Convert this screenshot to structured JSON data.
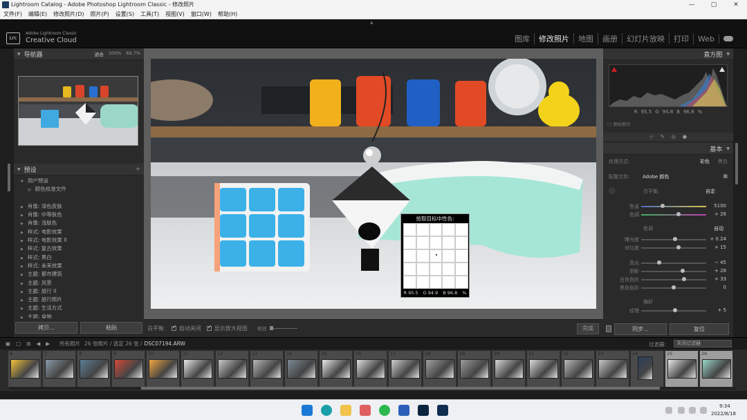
{
  "window": {
    "title": "Lightroom Catalog - Adobe Photoshop Lightroom Classic - 修改照片",
    "controls": [
      "—",
      "▢",
      "✕"
    ]
  },
  "menu": [
    "文件(F)",
    "编辑(E)",
    "修改照片(D)",
    "照片(P)",
    "设置(S)",
    "工具(T)",
    "视图(V)",
    "窗口(W)",
    "帮助(H)"
  ],
  "brand": {
    "logo": "Lrc",
    "line1": "Adobe Lightroom Classic",
    "line2": "Creative Cloud"
  },
  "modules": [
    {
      "label": "图库",
      "active": false
    },
    {
      "label": "修改照片",
      "active": true
    },
    {
      "label": "地图",
      "active": false
    },
    {
      "label": "画册",
      "active": false
    },
    {
      "label": "幻灯片放映",
      "active": false
    },
    {
      "label": "打印",
      "active": false
    },
    {
      "label": "Web",
      "active": false
    }
  ],
  "navigator": {
    "title": "导航器",
    "zoom": [
      "适合",
      "100%",
      "66.7%"
    ]
  },
  "presets": {
    "title": "预设",
    "items": [
      {
        "label": "用户预设",
        "expanded": true,
        "sub": false
      },
      {
        "label": "颜色校准文件",
        "expanded": false,
        "sub": true
      },
      {
        "label": "",
        "expanded": false,
        "sub": false
      },
      {
        "label": "肖像: 深色皮肤",
        "expanded": false,
        "sub": false
      },
      {
        "label": "肖像: 中等肤色",
        "expanded": false,
        "sub": false
      },
      {
        "label": "肖像: 浅肤色",
        "expanded": false,
        "sub": false
      },
      {
        "label": "样式: 电影效果",
        "expanded": false,
        "sub": false
      },
      {
        "label": "样式: 电影效果 II",
        "expanded": false,
        "sub": false
      },
      {
        "label": "样式: 复古效果",
        "expanded": false,
        "sub": false
      },
      {
        "label": "样式: 黑白",
        "expanded": false,
        "sub": false
      },
      {
        "label": "样式: 未来效果",
        "expanded": false,
        "sub": false
      },
      {
        "label": "主题: 都市建筑",
        "expanded": false,
        "sub": false
      },
      {
        "label": "主题: 风景",
        "expanded": false,
        "sub": false
      },
      {
        "label": "主题: 旅行 II",
        "expanded": false,
        "sub": false
      },
      {
        "label": "主题: 旅行照片",
        "expanded": false,
        "sub": false
      },
      {
        "label": "主题: 生活方式",
        "expanded": false,
        "sub": false
      },
      {
        "label": "主题: 食物",
        "expanded": false,
        "sub": false
      }
    ]
  },
  "left_buttons": {
    "copy": "拷贝...",
    "paste": "粘贴"
  },
  "toolbar": {
    "wb_label": "白平衡:",
    "auto_close": "自动关闭",
    "show_loupe": "显示放大视图",
    "scale": "缩放",
    "done": "完成"
  },
  "loupe": {
    "title": "拾取目标中性色:",
    "r": "R 95.5",
    "g": "G 94.9",
    "b": "B 96.8",
    "unit": "%"
  },
  "histogram": {
    "title": "直方图",
    "r_label": "R",
    "r_val": "95.5",
    "g_label": "G",
    "g_val": "94.8",
    "b_label": "B",
    "b_val": "96.8",
    "unit": "%",
    "original": "原始照片"
  },
  "basic": {
    "title": "基本",
    "treatment_label": "处理方式:",
    "treatment_color": "彩色",
    "treatment_bw": "黑白",
    "profile_label": "配置文件:",
    "profile_value": "Adobe 颜色",
    "wb_label": "白平衡:",
    "wb_value": "自定",
    "tone_label": "色调",
    "tone_auto": "自动",
    "presence_label": "偏好",
    "sliders": [
      {
        "label": "色温",
        "value": "5100",
        "pos": 0.33
      },
      {
        "label": "色调",
        "value": "+ 26",
        "pos": 0.57
      },
      {
        "label": "曝光度",
        "value": "+ 0.24",
        "pos": 0.52
      },
      {
        "label": "对比度",
        "value": "+ 15",
        "pos": 0.57
      },
      {
        "label": "高光",
        "value": "− 45",
        "pos": 0.28
      },
      {
        "label": "阴影",
        "value": "+ 28",
        "pos": 0.64
      },
      {
        "label": "白色色阶",
        "value": "+ 33",
        "pos": 0.66
      },
      {
        "label": "黑色色阶",
        "value": "0",
        "pos": 0.5
      },
      {
        "label": "纹理",
        "value": "+ 5",
        "pos": 0.52
      }
    ]
  },
  "right_buttons": {
    "sync": "同步...",
    "reset": "复位"
  },
  "filmbar": {
    "source": "所有照片",
    "count": "26 张照片 / 选定 26 张 /",
    "filename": "DSC07194.ARW",
    "filter_label": "过滤器:",
    "filter_value": "关闭过滤器"
  },
  "filmstrip": [
    "6",
    "7",
    "8",
    "9",
    "10",
    "11",
    "12",
    "13",
    "14",
    "15",
    "16",
    "17",
    "18",
    "19",
    "20",
    "21",
    "22",
    "23",
    "24",
    "25",
    "26"
  ],
  "taskbar": {
    "time": "9:34",
    "date": "2022/8/18"
  }
}
